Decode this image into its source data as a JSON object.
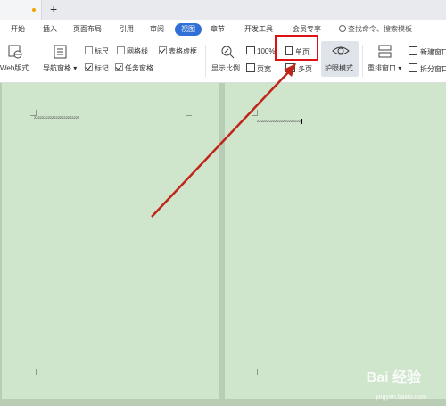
{
  "titlebar": {
    "new_tab": "+"
  },
  "menu": {
    "items": [
      "开始",
      "插入",
      "页面布局",
      "引用",
      "审阅",
      "视图",
      "章节",
      "开发工具",
      "会员专享"
    ],
    "active": "视图",
    "search_placeholder": "查找命令、搜索模板"
  },
  "ribbon": {
    "web_layout": "Web版式",
    "nav_pane": "导航窗格",
    "ruler": "标尺",
    "gridlines": "网格线",
    "table_gridlines": "表格虚框",
    "markup": "标记",
    "task_pane": "任务窗格",
    "zoom": "显示比例",
    "zoom_100": "100%",
    "page_width": "页宽",
    "single_page": "单页",
    "multi_page": "多页",
    "eye_mode": "护眼模式",
    "arrange": "重排窗口",
    "new_window": "新建窗口",
    "split_window": "拆分窗口"
  },
  "document": {
    "left_page_text": "22222222222222222222222",
    "right_page_text": "22222222222222222222222"
  },
  "watermark": {
    "brand": "Bai 经验",
    "url": "jingyan.baidu.com"
  },
  "colors": {
    "accent": "#2f6fd6",
    "eye_green": "#cfe5cc",
    "annotation_red": "#d11"
  }
}
